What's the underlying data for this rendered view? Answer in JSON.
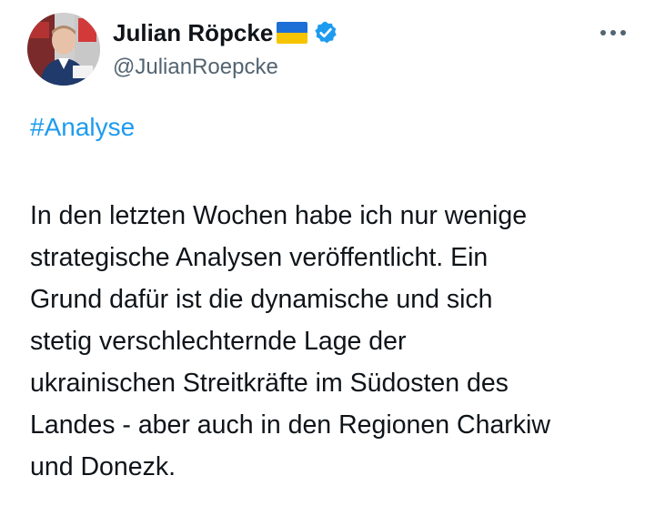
{
  "author": {
    "display_name": "Julian Röpcke",
    "handle": "@JulianRoepcke",
    "flag_icon": "ukraine-flag-icon",
    "verified_icon": "verified-badge-icon",
    "verified_color": "#1d9bf0"
  },
  "menu": {
    "more_icon": "more-horizontal-icon"
  },
  "tweet": {
    "hashtag": "#Analyse",
    "hashtag_color": "#1d9bf0",
    "lines": [
      "In den letzten Wochen habe ich nur wenige",
      "strategische Analysen veröffentlicht. Ein",
      "Grund dafür ist die dynamische und sich",
      "stetig verschlechternde Lage der",
      "ukrainischen Streitkräfte im Südosten des",
      "Landes - aber auch in den Regionen Charkiw",
      "und Donezk."
    ]
  }
}
